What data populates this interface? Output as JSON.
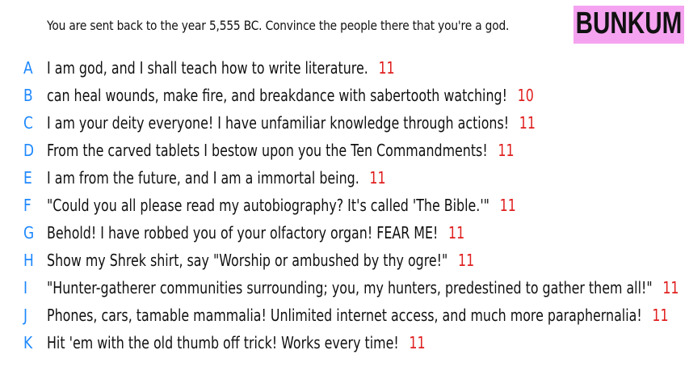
{
  "prompt": "You are sent back to the year 5,555 BC. Convince the people there that you're a god.",
  "logo": {
    "text": "BUNKUM",
    "background": "#f5a3f0"
  },
  "colors": {
    "letter": "#1e88ff",
    "score": "#e02020",
    "text": "#111111"
  },
  "answers": [
    {
      "letter": "A",
      "text": "I am god, and I shall teach how to write literature.",
      "score": "11"
    },
    {
      "letter": "B",
      "text": "can heal wounds, make fire, and breakdance with sabertooth watching!",
      "score": "10"
    },
    {
      "letter": "C",
      "text": "I am your deity everyone! I have unfamiliar knowledge through actions!",
      "score": "11"
    },
    {
      "letter": "D",
      "text": "From the carved tablets I bestow upon you the Ten Commandments!",
      "score": "11"
    },
    {
      "letter": "E",
      "text": "I am from the future, and I am a immortal being.",
      "score": "11"
    },
    {
      "letter": "F",
      "text": "\"Could you all please read my autobiography? It's called 'The Bible.'\"",
      "score": "11"
    },
    {
      "letter": "G",
      "text": "Behold! I have robbed you of your olfactory organ! FEAR ME!",
      "score": "11"
    },
    {
      "letter": "H",
      "text": "Show my Shrek shirt, say \"Worship or ambushed by thy ogre!\"",
      "score": "11"
    },
    {
      "letter": "I",
      "text": "\"Hunter-gatherer communities surrounding; you, my hunters, predestined to gather them all!\"",
      "score": "11"
    },
    {
      "letter": "J",
      "text": "Phones, cars, tamable mammalia! Unlimited internet access, and much more paraphernalia!",
      "score": "11"
    },
    {
      "letter": "K",
      "text": "Hit 'em with the old thumb off trick! Works every time!",
      "score": "11"
    }
  ]
}
